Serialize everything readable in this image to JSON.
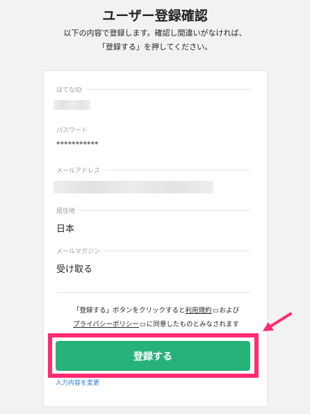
{
  "header": {
    "title": "ユーザー登録確認",
    "desc_line1": "以下の内容で登録します。確認し間違いがなければ、",
    "desc_line2": "「登録する」を押してください。"
  },
  "fields": {
    "hatena_id": {
      "label": "はてなID"
    },
    "password": {
      "label": "パスワード",
      "value": "***********"
    },
    "email": {
      "label": "メールアドレス"
    },
    "residence": {
      "label": "居住地",
      "value": "日本"
    },
    "magazine": {
      "label": "メールマガジン",
      "value": "受け取る"
    }
  },
  "terms": {
    "prefix": "「登録する」ボタンをクリックすると",
    "terms_link": "利用規約",
    "and": "および",
    "privacy_link": "プライバシーポリシー",
    "suffix": "に同意したものとみなされます"
  },
  "submit_label": "登録する",
  "edit_link": "入力内容を変更",
  "colors": {
    "button": "#27b27a",
    "highlight": "#ff2b72",
    "link": "#2a7bd0"
  }
}
